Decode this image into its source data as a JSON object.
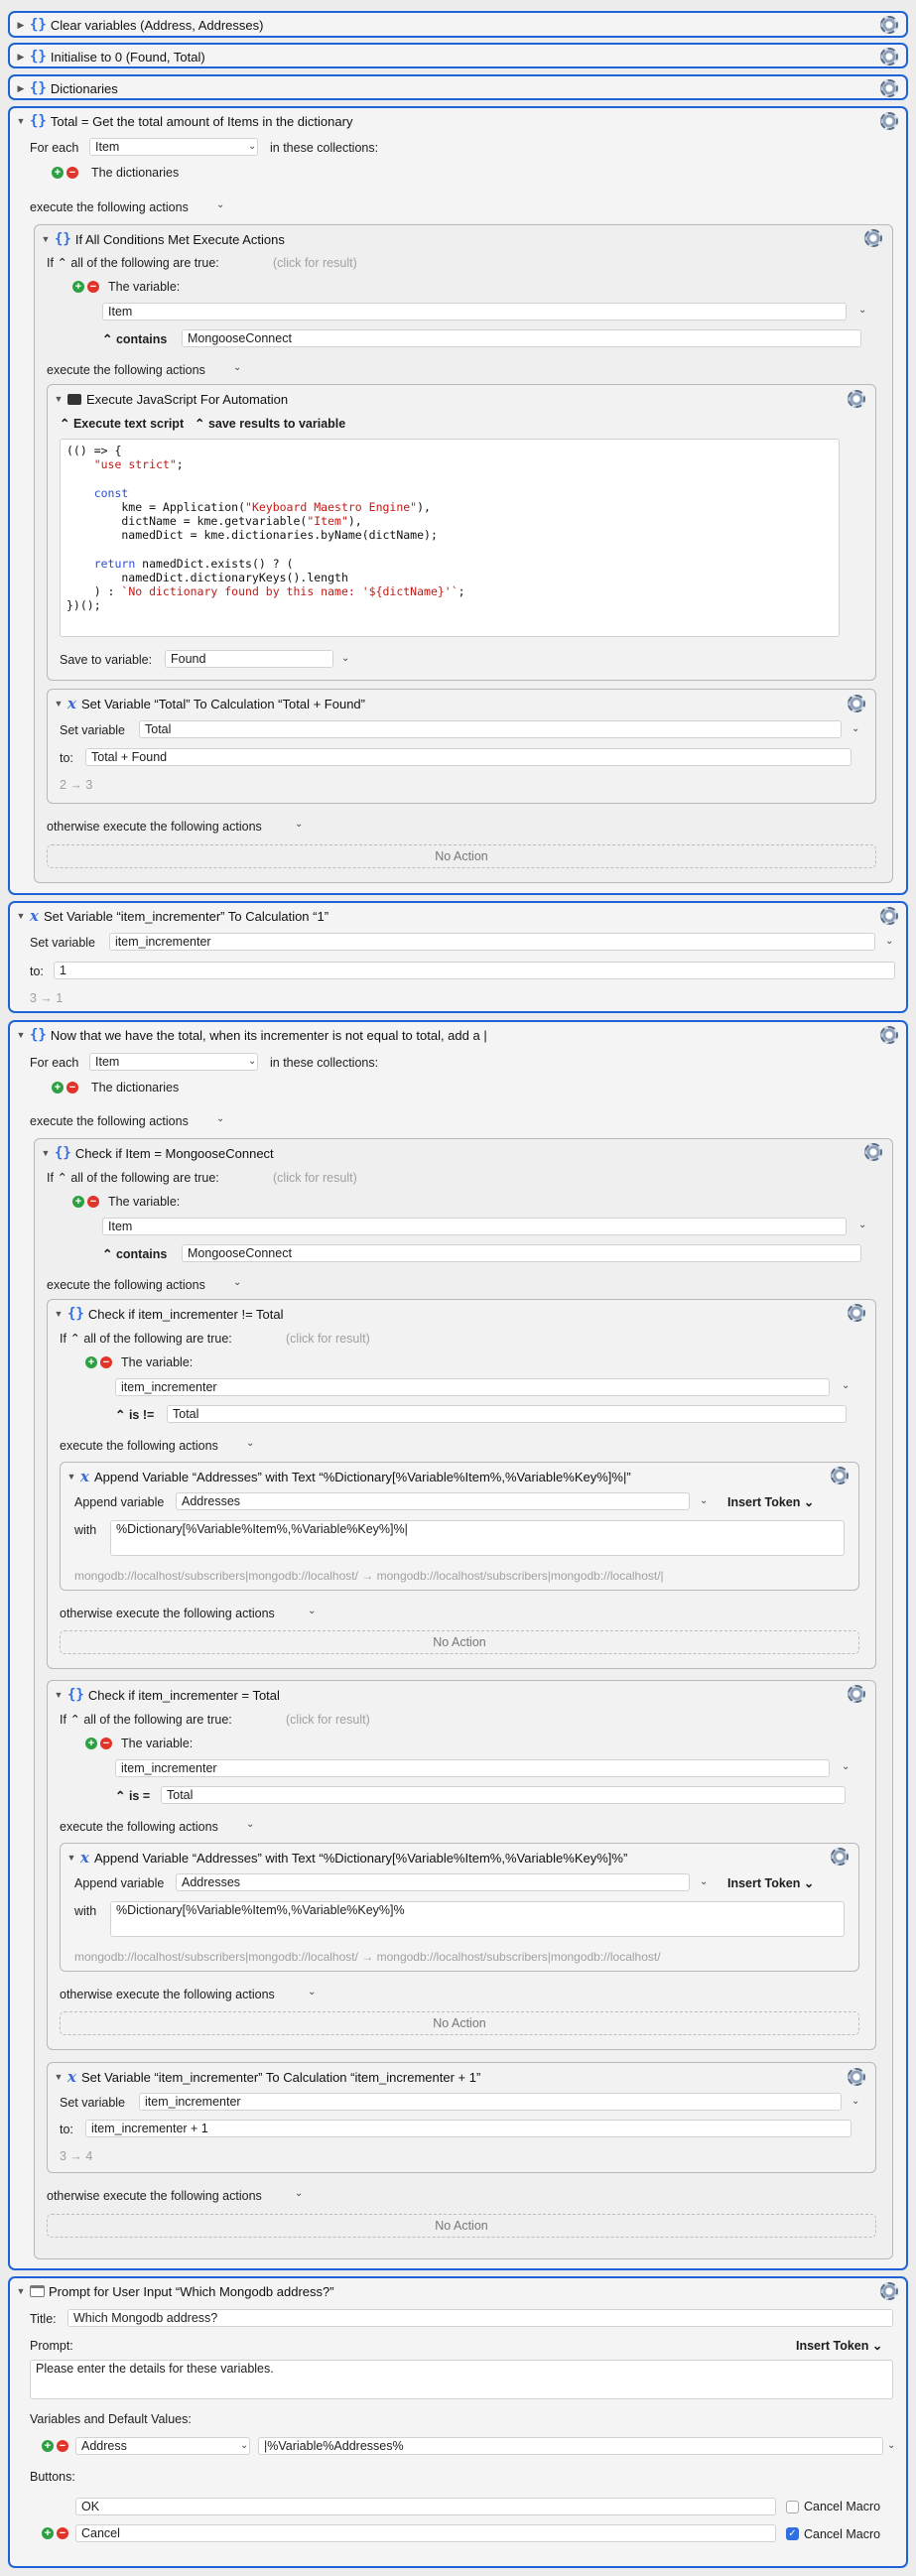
{
  "collapsed_actions": [
    {
      "title": "Clear variables (Address, Addresses)"
    },
    {
      "title": "Initialise to 0 (Found, Total)"
    },
    {
      "title": "Dictionaries"
    }
  ],
  "total_group": {
    "title": "Total = Get the total amount of Items in the dictionary",
    "for_each_label": "For each",
    "for_each_var": "Item",
    "in_collections": "in these collections:",
    "collection": "The dictionaries",
    "execute_label": "execute the following actions",
    "if_block": {
      "title": "If All Conditions Met Execute Actions",
      "if_label": "If",
      "condition_mode": "all of the following are true:",
      "click_for_result": "(click for result)",
      "variable_label": "The variable:",
      "variable": "Item",
      "operator": "contains",
      "value": "MongooseConnect",
      "execute_label": "execute the following actions",
      "js": {
        "title": "Execute JavaScript For Automation",
        "text_script": "Execute text script",
        "save_results": "save results to variable",
        "code_lines": [
          "(() => {",
          "    \"use strict\";",
          "",
          "    const",
          "        kme = Application(\"Keyboard Maestro Engine\"),",
          "        dictName = kme.getvariable(\"Item\"),",
          "        namedDict = kme.dictionaries.byName(dictName);",
          "",
          "    return namedDict.exists() ? (",
          "        namedDict.dictionaryKeys().length",
          "    ) : `No dictionary found by this name: '${dictName}'`;",
          "})();"
        ],
        "save_to_label": "Save to variable:",
        "save_to_var": "Found"
      },
      "set_total": {
        "title": "Set Variable “Total” To Calculation “Total + Found”",
        "set_label": "Set variable",
        "var": "Total",
        "to_label": "to:",
        "to_value": "Total + Found",
        "result": "2 → 3"
      },
      "otherwise_label": "otherwise execute the following actions",
      "no_action": "No Action"
    }
  },
  "set_incrementer": {
    "title": "Set Variable “item_incrementer” To Calculation “1”",
    "set_label": "Set variable",
    "var": "item_incrementer",
    "to_label": "to:",
    "to_value": "1",
    "result": "3 → 1"
  },
  "append_group": {
    "title": "Now that we have the total, when its incrementer is not equal to total, add a |",
    "for_each_label": "For each",
    "for_each_var": "Item",
    "in_collections": "in these collections:",
    "collection": "The dictionaries",
    "execute_label": "execute the following actions",
    "check_item": {
      "title": "Check if Item = MongooseConnect",
      "if_label": "If",
      "condition_mode": "all of the following are true:",
      "click_for_result": "(click for result)",
      "variable_label": "The variable:",
      "variable": "Item",
      "operator": "contains",
      "value": "MongooseConnect",
      "execute_label": "execute the following actions",
      "check_ne": {
        "title": "Check if item_incrementer != Total",
        "if_label": "If",
        "condition_mode": "all of the following are true:",
        "click_for_result": "(click for result)",
        "variable_label": "The variable:",
        "variable": "item_incrementer",
        "operator": "is !=",
        "value": "Total",
        "execute_label": "execute the following actions",
        "append": {
          "title": "Append Variable “Addresses” with Text “%Dictionary[%Variable%Item%,%Variable%Key%]%|”",
          "append_label": "Append variable",
          "var": "Addresses",
          "insert_token": "Insert Token",
          "with_label": "with",
          "text": "%Dictionary[%Variable%Item%,%Variable%Key%]%|",
          "result": "mongodb://localhost/subscribers|mongodb://localhost/ → mongodb://localhost/subscribers|mongodb://localhost/|"
        },
        "otherwise_label": "otherwise execute the following actions",
        "no_action": "No Action"
      },
      "check_eq": {
        "title": "Check if item_incrementer = Total",
        "if_label": "If",
        "condition_mode": "all of the following are true:",
        "click_for_result": "(click for result)",
        "variable_label": "The variable:",
        "variable": "item_incrementer",
        "operator": "is =",
        "value": "Total",
        "execute_label": "execute the following actions",
        "append": {
          "title": "Append Variable “Addresses” with Text “%Dictionary[%Variable%Item%,%Variable%Key%]%”",
          "append_label": "Append variable",
          "var": "Addresses",
          "insert_token": "Insert Token",
          "with_label": "with",
          "text": "%Dictionary[%Variable%Item%,%Variable%Key%]%",
          "result": "mongodb://localhost/subscribers|mongodb://localhost/ → mongodb://localhost/subscribers|mongodb://localhost/"
        },
        "otherwise_label": "otherwise execute the following actions",
        "no_action": "No Action"
      },
      "set_inc": {
        "title": "Set Variable “item_incrementer” To Calculation “item_incrementer + 1”",
        "set_label": "Set variable",
        "var": "item_incrementer",
        "to_label": "to:",
        "to_value": "item_incrementer + 1",
        "result": "3 → 4"
      },
      "otherwise_label": "otherwise execute the following actions",
      "no_action": "No Action"
    }
  },
  "prompt": {
    "title": "Prompt for User Input “Which Mongodb address?”",
    "title_label": "Title:",
    "title_value": "Which Mongodb address?",
    "prompt_label": "Prompt:",
    "insert_token": "Insert Token",
    "prompt_text": "Please enter the details for these variables.",
    "vars_label": "Variables and Default Values:",
    "var_name": "Address",
    "var_default": "|%Variable%Addresses%",
    "buttons_label": "Buttons:",
    "buttons": [
      {
        "label": "OK",
        "cancel_macro": "Cancel Macro",
        "checked": false
      },
      {
        "label": "Cancel",
        "cancel_macro": "Cancel Macro",
        "checked": true
      }
    ]
  },
  "colors": {
    "accent": "#1e63d6",
    "string": "#c41a16",
    "keyword": "#2a4fd6"
  }
}
